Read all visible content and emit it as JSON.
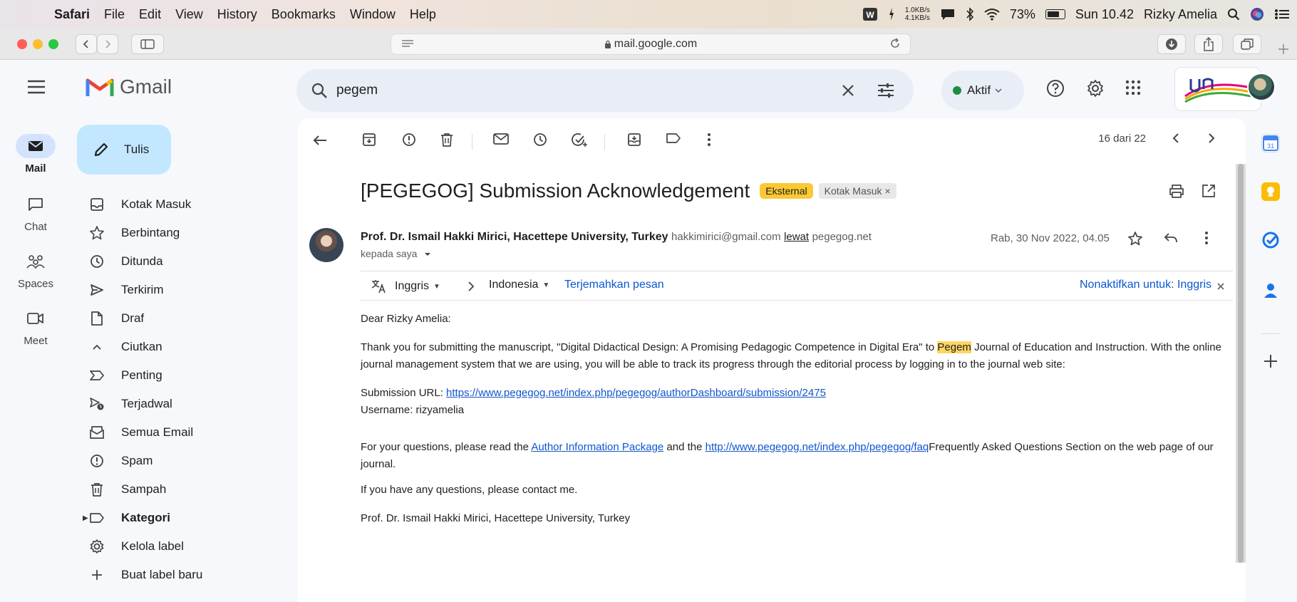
{
  "menubar": {
    "app": "Safari",
    "items": [
      "File",
      "Edit",
      "View",
      "History",
      "Bookmarks",
      "Window",
      "Help"
    ],
    "net_up": "1.0KB/s",
    "net_down": "4.1KB/s",
    "battery": "73%",
    "battery_level": 0.73,
    "clock": "Sun 10.42",
    "user": "Rizky Amelia"
  },
  "browser": {
    "url": "mail.google.com"
  },
  "gmail": {
    "logo_text": "Gmail",
    "search_value": "pegem",
    "status": "Aktif",
    "rail": [
      {
        "label": "Mail"
      },
      {
        "label": "Chat"
      },
      {
        "label": "Spaces"
      },
      {
        "label": "Meet"
      }
    ],
    "compose_label": "Tulis",
    "nav": [
      {
        "label": "Kotak Masuk",
        "icon": "inbox-icon"
      },
      {
        "label": "Berbintang",
        "icon": "star-icon"
      },
      {
        "label": "Ditunda",
        "icon": "clock-icon"
      },
      {
        "label": "Terkirim",
        "icon": "send-icon"
      },
      {
        "label": "Draf",
        "icon": "draft-icon"
      },
      {
        "label": "Ciutkan",
        "icon": "collapse-icon"
      },
      {
        "label": "Penting",
        "icon": "important-icon"
      },
      {
        "label": "Terjadwal",
        "icon": "scheduled-icon"
      },
      {
        "label": "Semua Email",
        "icon": "all-mail-icon"
      },
      {
        "label": "Spam",
        "icon": "spam-icon"
      },
      {
        "label": "Sampah",
        "icon": "trash-icon"
      },
      {
        "label": "Kategori",
        "icon": "label-icon"
      },
      {
        "label": "Kelola label",
        "icon": "gear-icon"
      },
      {
        "label": "Buat label baru",
        "icon": "plus-icon"
      }
    ]
  },
  "message": {
    "pager": "16 dari 22",
    "subject": "[PEGEGOG] Submission Acknowledgement",
    "tag_external": "Eksternal",
    "tag_inbox": "Kotak Masuk",
    "sender_name": "Prof. Dr. Ismail Hakki Mirici, Hacettepe University, Turkey",
    "sender_email": "hakkimirici@gmail.com",
    "via_label": "lewat",
    "via_domain": "pegegog.net",
    "to": "kepada saya",
    "date": "Rab, 30 Nov 2022, 04.05",
    "translate": {
      "from": "Inggris",
      "to": "Indonesia",
      "action": "Terjemahkan pesan",
      "disable": "Nonaktifkan untuk: Inggris"
    },
    "body": {
      "greeting": "Dear Rizky Amelia:",
      "p1_a": "Thank you for submitting the manuscript, \"Digital Didactical Design: A Promising Pedagogic Competence in Digital Era\" to ",
      "p1_hl": "Pegem",
      "p1_b": " Journal of Education and Instruction. With the online journal management system that we are using, you will be able to track its progress through the editorial process by logging in to the journal web site:",
      "url_label": "Submission URL: ",
      "url": "https://www.pegegog.net/index.php/pegegog/authorDashboard/submission/2475",
      "username": "Username: rizyamelia",
      "p3_a": "For your questions, please read the ",
      "p3_link1": "Author Information Package",
      "p3_b": " and the ",
      "p3_link2": "http://www.pegegog.net/index.php/pegegog/faq",
      "p3_c": "Frequently Asked Questions Section on the web page of our journal.",
      "p4": "If you have any questions, please contact me.",
      "signature": "Prof. Dr. Ismail Hakki Mirici, Hacettepe University, Turkey"
    }
  },
  "colors": {
    "compose_bg": "#c2e7ff",
    "highlight": "#fdd663",
    "external_tag": "#fcc934",
    "link": "#1155cc",
    "status_green": "#1e8e3e"
  }
}
